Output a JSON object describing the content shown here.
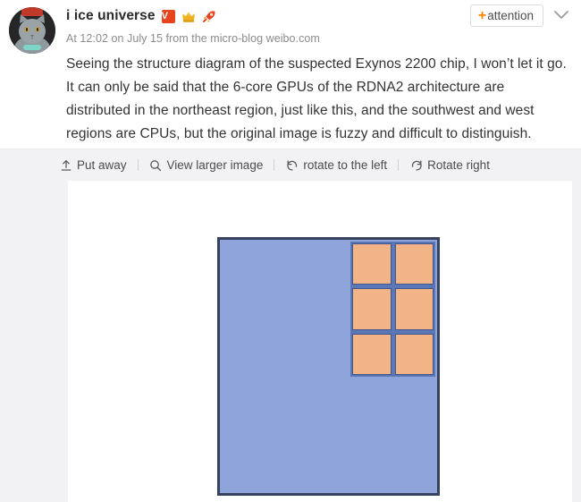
{
  "post": {
    "avatar_alt": "cat-avatar",
    "username": "i ice universe",
    "badges": [
      {
        "name": "verified-badge",
        "label": "V"
      },
      {
        "name": "crown-badge",
        "label": ""
      },
      {
        "name": "rocket-badge",
        "label": ""
      }
    ],
    "meta": "At 12:02 on July 15 from the micro-blog weibo.com",
    "body": "Seeing the structure diagram of the suspected Exynos 2200 chip, I won’t let it go. It can only be said that the 6-core GPUs of the RDNA2 architecture are distributed in the northeast region, just like this, and the southwest and west regions are CPUs, but the original image is fuzzy and difficult to distinguish.",
    "attention_button": {
      "plus": "+",
      "label": "attention"
    },
    "expand_icon": "chevron-down-icon"
  },
  "toolbar": {
    "items": [
      {
        "icon": "put-away-icon",
        "label": "Put away"
      },
      {
        "icon": "magnifier-icon",
        "label": "View larger image"
      },
      {
        "icon": "rotate-left-icon",
        "label": "rotate to the left"
      },
      {
        "icon": "rotate-right-icon",
        "label": "Rotate right"
      }
    ]
  },
  "diagram": {
    "name": "exynos-2200-chip-die-diagram",
    "die_color": "#8ea4db",
    "die_border_color": "#36425e",
    "gpu_core_color": "#f2b386",
    "gpu_core_border_color": "#44558a",
    "gpu_grid_bg_color": "#5a77b8",
    "gpu_core_count": 6,
    "gpu_grid_columns": 2,
    "gpu_grid_rows": 3,
    "gpu_cores": [
      "gpu-core-1",
      "gpu-core-2",
      "gpu-core-3",
      "gpu-core-4",
      "gpu-core-5",
      "gpu-core-6"
    ]
  },
  "colors": {
    "accent_orange": "#ff8200",
    "verified_red": "#e8431f",
    "toolbar_bg": "#f2f2f4",
    "text_primary": "#333333",
    "text_meta": "#8c8c8c"
  }
}
